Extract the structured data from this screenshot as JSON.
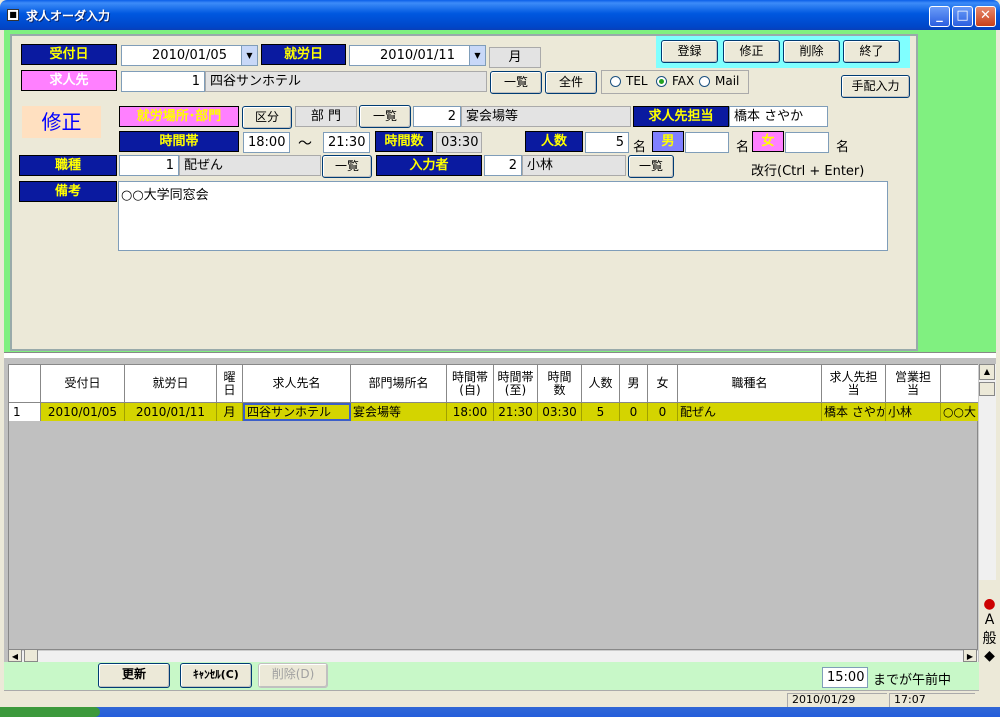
{
  "window": {
    "title": "求人オーダ入力"
  },
  "form": {
    "uketsuke_label": "受付日",
    "uketsuke_value": "2010/01/05",
    "shuuro_label": "就労日",
    "shuuro_value": "2010/01/11",
    "weekday_value": "月",
    "kyujinsaki_label": "求人先",
    "kyujinsaki_code": "1",
    "kyujinsaki_name": "四谷サンホテル",
    "ichiran_label": "一覧",
    "zenken_label": "全件",
    "radio_tel": "TEL",
    "radio_fax": "FAX",
    "radio_mail": "Mail",
    "mode_label": "修正",
    "basho_label": "就労場所･部門",
    "kubun_label": "区分",
    "bumon_label": "部 門",
    "bumon_code": "2",
    "bumon_name": "宴会場等",
    "tantou_label": "求人先担当",
    "tantou_value": "橋本 さやか",
    "jikantai_label": "時間帯",
    "time_from": "18:00",
    "tilde": "～",
    "time_to": "21:30",
    "jikansu_label": "時間数",
    "jikansu_value": "03:30",
    "ninzu_label": "人数",
    "ninzu_value": "5",
    "mei1": "名",
    "otoko_label": "男",
    "otoko_value": "",
    "mei2": "名",
    "onna_label": "女",
    "onna_value": "",
    "mei3": "名",
    "shokushu_label": "職種",
    "shokushu_code": "1",
    "shokushu_name": "配ぜん",
    "nyuryoku_label": "入力者",
    "nyuryoku_code": "2",
    "nyuryoku_name": "小林",
    "kaigyo_hint": "改行(Ctrl + Enter)",
    "bikou_label": "備考",
    "bikou_value": "○○大学同窓会"
  },
  "toolbar": {
    "touroku": "登録",
    "shuusei": "修正",
    "sakujo": "削除",
    "shuuryou": "終了",
    "tehai": "手配入力"
  },
  "grid": {
    "headers": [
      "受付日",
      "就労日",
      "曜\n日",
      "求人先名",
      "部門場所名",
      "時間帯\n(自)",
      "時間帯\n(至)",
      "時間\n数",
      "人数",
      "男",
      "女",
      "職種名",
      "求人先担\n当",
      "営業担\n当",
      ""
    ],
    "rows": [
      {
        "num": "1",
        "uketsuke": "2010/01/05",
        "shuuro": "2010/01/11",
        "youbi": "月",
        "kyujinsaki": "四谷サンホテル",
        "bumon": "宴会場等",
        "from": "18:00",
        "to": "21:30",
        "jikan": "03:30",
        "ninzu": "5",
        "otoko": "0",
        "onna": "0",
        "shokushu": "配ぜん",
        "tantou": "橋本 さやか",
        "eigyo": "小林",
        "bikou": "○○大"
      }
    ]
  },
  "bottom": {
    "koushin": "更新",
    "cancel": "ｷｬﾝｾﾙ(C)",
    "sakujo": "削除(D)",
    "time_value": "15:00",
    "time_suffix": "までが午前中"
  },
  "status": {
    "date": "2010/01/29",
    "time": "17:07"
  }
}
